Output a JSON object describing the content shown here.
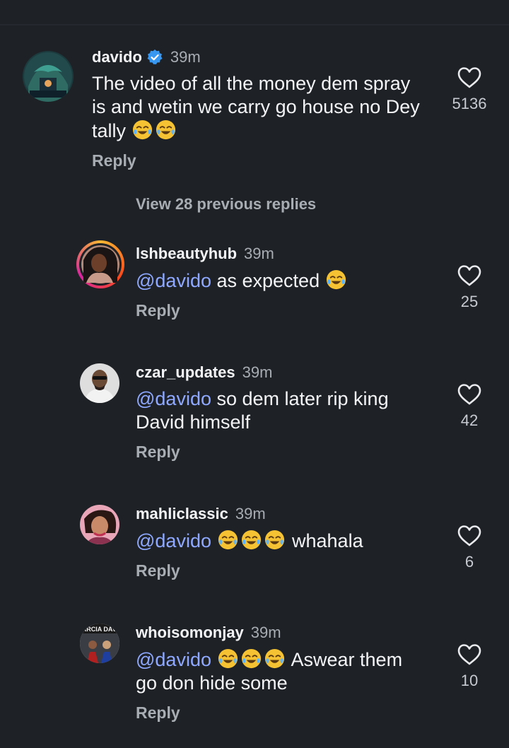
{
  "main_comment": {
    "username": "davido",
    "time": "39m",
    "text_lines": [
      "The video of all the money dem spray",
      "is and wetin we carry go house no Dey",
      "tally"
    ],
    "emoji_count_after_text": 2,
    "reply_label": "Reply",
    "like_count": "5136",
    "verified": true
  },
  "view_replies_label": "View 28 previous replies",
  "replies": [
    {
      "username": "lshbeautyhub",
      "time": "39m",
      "mention": "@davido",
      "text": " as expected ",
      "emojis_after": 1,
      "reply_label": "Reply",
      "like_count": "25",
      "has_story_ring": true
    },
    {
      "username": "czar_updates",
      "time": "39m",
      "mention": "@davido",
      "text": " so dem later rip king",
      "text_line2": "David himself",
      "reply_label": "Reply",
      "like_count": "42"
    },
    {
      "username": "mahliclassic",
      "time": "39m",
      "mention": "@davido",
      "emojis_before": 3,
      "text": " whahala",
      "reply_label": "Reply",
      "like_count": "6"
    },
    {
      "username": "whoisomonjay",
      "time": "39m",
      "mention": "@davido",
      "emojis_before": 3,
      "text": " Aswear them",
      "text_line2": "go don hide some",
      "reply_label": "Reply",
      "like_count": "10"
    }
  ],
  "colors": {
    "background": "#1e2126",
    "mention": "#8ea9ff",
    "verified_badge": "#3897f0",
    "muted_text": "#a8adb4"
  },
  "icons": {
    "like": "heart-outline-icon",
    "verified": "verified-badge-icon",
    "emoji": "face-with-tears-of-joy"
  }
}
